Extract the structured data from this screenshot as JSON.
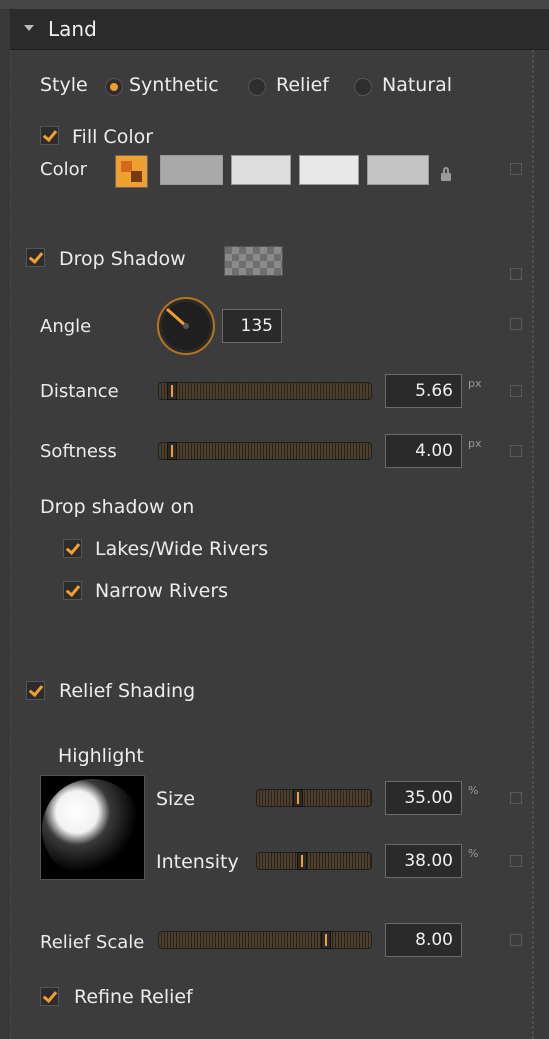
{
  "section": {
    "title": "Land"
  },
  "style": {
    "label": "Style",
    "options": [
      {
        "label": "Synthetic",
        "selected": true
      },
      {
        "label": "Relief",
        "selected": false
      },
      {
        "label": "Natural",
        "selected": false
      }
    ]
  },
  "fill_color": {
    "label": "Fill Color",
    "checked": true
  },
  "color": {
    "label": "Color"
  },
  "drop_shadow": {
    "label": "Drop Shadow",
    "checked": true,
    "angle": {
      "label": "Angle",
      "value": "135"
    },
    "distance": {
      "label": "Distance",
      "value": "5.66",
      "unit": "px",
      "fraction": 0.04
    },
    "softness": {
      "label": "Softness",
      "value": "4.00",
      "unit": "px",
      "fraction": 0.04
    },
    "on_label": "Drop shadow on",
    "lakes": {
      "label": "Lakes/Wide Rivers",
      "checked": true
    },
    "narrow": {
      "label": "Narrow Rivers",
      "checked": true
    }
  },
  "relief_shading": {
    "label": "Relief Shading",
    "checked": true,
    "highlight_label": "Highlight",
    "size": {
      "label": "Size",
      "value": "35.00",
      "unit": "%",
      "fraction": 0.35
    },
    "intensity": {
      "label": "Intensity",
      "value": "38.00",
      "unit": "%",
      "fraction": 0.38
    }
  },
  "relief_scale": {
    "label": "Relief Scale",
    "value": "8.00",
    "fraction": 0.8
  },
  "refine_relief": {
    "label": "Refine Relief",
    "checked": true
  },
  "colors": {
    "accent": "#f0a030",
    "panel": "#3c3c3c",
    "header": "#2b2b2b"
  }
}
